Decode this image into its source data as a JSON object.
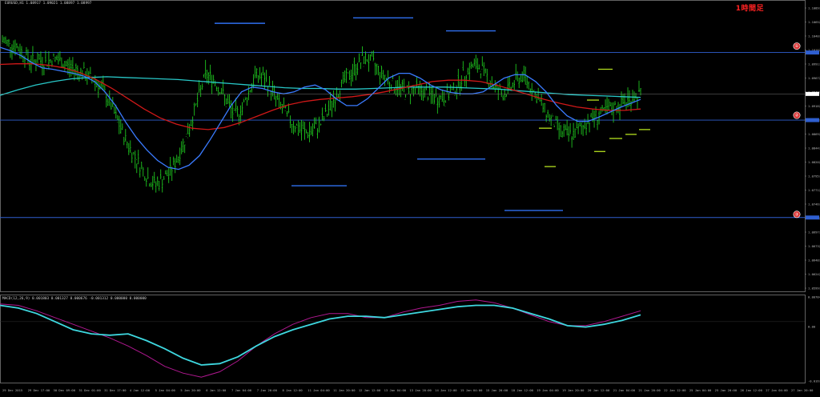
{
  "chart_header": {
    "symbol_line": "EURUSD,H1  1.08917 1.09021 1.08897 1.08997",
    "timeframe_label": "1時間足"
  },
  "indicator_header": "MACD(12,26,9) 0.001803 0.001327 0.000676 -0.001312 0.000000 0.000000",
  "markers": [
    "①",
    "②",
    "③"
  ],
  "colors": {
    "background": "#000000",
    "candle": "#22dd22",
    "ma_fast": "#3a7bff",
    "ma_mid": "#d01818",
    "ma_slow": "#28c8c8",
    "level_line": "#2f5fd0",
    "support_resist": "#2f6ff0",
    "yellow_marks": "#b4e01e",
    "macd_main": "#3ed8e0",
    "macd_signal": "#b01890",
    "grid": "#2a2a2a"
  },
  "chart_data": [
    {
      "type": "line",
      "subtype": "candlestick",
      "title": "EURUSD,H1",
      "series": [
        {
          "name": "candles",
          "style": "ohlc-bars",
          "values": [
            1.0999,
            1.0996,
            1.099,
            1.098,
            1.097,
            1.0972,
            1.0968,
            1.0974,
            1.097,
            1.0962,
            1.0958,
            1.0954,
            1.0946,
            1.094,
            1.0925,
            1.0905,
            1.088,
            1.0855,
            1.0835,
            1.0818,
            1.08,
            1.079,
            1.0797,
            1.0806,
            1.0825,
            1.085,
            1.088,
            1.0915,
            1.095,
            1.0945,
            1.093,
            1.091,
            1.089,
            1.09,
            1.0925,
            1.095,
            1.0945,
            1.093,
            1.091,
            1.0895,
            1.088,
            1.087,
            1.0865,
            1.087,
            1.088,
            1.09,
            1.092,
            1.094,
            1.095,
            1.0965,
            1.0975,
            1.0968,
            1.0955,
            1.0945,
            1.0935,
            1.093,
            1.0925,
            1.093,
            1.0925,
            1.092,
            1.0915,
            1.0918,
            1.0925,
            1.094,
            1.0955,
            1.0963,
            1.096,
            1.0945,
            1.093,
            1.0922,
            1.093,
            1.0945,
            1.0948,
            1.093,
            1.0912,
            1.0895,
            1.088,
            1.0868,
            1.0862,
            1.0865,
            1.0875,
            1.0885,
            1.089,
            1.0895,
            1.09,
            1.0905,
            1.0912,
            1.0918,
            1.0922
          ]
        },
        {
          "name": "ma_fast",
          "values": [
            1.099,
            1.0985,
            1.0978,
            1.0968,
            1.096,
            1.0958,
            1.0955,
            1.0952,
            1.0948,
            1.094,
            1.0925,
            1.0905,
            1.088,
            1.0858,
            1.084,
            1.0825,
            1.0815,
            1.0812,
            1.0818,
            1.0832,
            1.0855,
            1.088,
            1.0905,
            1.0925,
            1.0932,
            1.093,
            1.0925,
            1.0922,
            1.0925,
            1.0932,
            1.0935,
            1.0928,
            1.0915,
            1.0905,
            1.0905,
            1.0915,
            1.093,
            1.0945,
            1.0952,
            1.0952,
            1.0945,
            1.0935,
            1.0928,
            1.0924,
            1.0922,
            1.0922,
            1.0925,
            1.0935,
            1.0945,
            1.095,
            1.095,
            1.094,
            1.0925,
            1.0905,
            1.089,
            1.0882,
            1.0882,
            1.0888,
            1.0895,
            1.0902,
            1.0908,
            1.0914
          ]
        },
        {
          "name": "ma_mid",
          "values": [
            1.0965,
            1.0966,
            1.0966,
            1.0964,
            1.096,
            1.0953,
            1.0943,
            1.093,
            1.0915,
            1.09,
            1.0887,
            1.0878,
            1.0872,
            1.087,
            1.0873,
            1.088,
            1.0889,
            1.0898,
            1.0906,
            1.0911,
            1.0914,
            1.0916,
            1.0918,
            1.0921,
            1.0925,
            1.093,
            1.0935,
            1.094,
            1.0942,
            1.0942,
            1.094,
            1.0935,
            1.0928,
            1.0921,
            1.0914,
            1.0908,
            1.0903,
            1.09,
            1.0898,
            1.0898,
            1.09
          ]
        },
        {
          "name": "ma_slow",
          "values": [
            1.092,
            1.0928,
            1.0935,
            1.094,
            1.0944,
            1.0946,
            1.0947,
            1.0946,
            1.0945,
            1.0944,
            1.0943,
            1.0941,
            1.0939,
            1.0937,
            1.0935,
            1.0933,
            1.0931,
            1.093,
            1.093,
            1.0929,
            1.0929,
            1.093,
            1.0931,
            1.0932,
            1.0932,
            1.0932,
            1.0931,
            1.093,
            1.0929,
            1.0927,
            1.0925,
            1.0923,
            1.0921,
            1.092,
            1.0919,
            1.0918,
            1.0917
          ]
        }
      ],
      "reference_lines": [
        {
          "name": "level-1",
          "value": 1.09824,
          "marker": "①"
        },
        {
          "name": "level-2",
          "value": 1.08838,
          "marker": "②"
        },
        {
          "name": "level-3",
          "value": 1.07417,
          "marker": "③"
        }
      ],
      "ylim": [
        1.0634,
        1.1052
      ],
      "y_tick_labels": [
        "1.10897",
        "1.10652",
        "1.10407",
        "1.10162",
        "1.09917",
        "1.09672",
        "1.09427",
        "1.09182",
        "1.08937",
        "1.08692",
        "1.08447",
        "1.08202",
        "1.07957",
        "1.07712",
        "1.07467",
        "1.07222",
        "1.06977",
        "1.06732",
        "1.06487",
        "1.06242",
        "1.05997"
      ],
      "x_tick_labels": [
        "29 Dec 2015",
        "29 Dec 17:00",
        "30 Dec 09:00",
        "31 Dec 01:00",
        "31 Dec 17:00",
        "4 Jan 12:00",
        "5 Jan 04:00",
        "5 Jan 20:00",
        "6 Jan 12:00",
        "7 Jan 04:00",
        "7 Jan 20:00",
        "8 Jan 12:00",
        "11 Jan 04:00",
        "11 Jan 20:00",
        "12 Jan 12:00",
        "13 Jan 04:00",
        "13 Jan 20:00",
        "14 Jan 12:00",
        "15 Jan 04:00",
        "15 Jan 20:00",
        "18 Jan 12:00",
        "19 Jan 04:00",
        "19 Jan 20:00",
        "20 Jan 12:00",
        "21 Jan 04:00",
        "21 Jan 20:00",
        "22 Jan 12:00",
        "25 Jan 04:00",
        "25 Jan 20:00",
        "26 Jan 12:00",
        "27 Jan 04:00",
        "27 Jan 20:00"
      ],
      "grid": false
    },
    {
      "type": "line",
      "title": "MACD(12,26,9)",
      "series": [
        {
          "name": "main",
          "values": [
            0.0012,
            0.001,
            0.0006,
            0.0,
            -0.0006,
            -0.0009,
            -0.001,
            -0.0009,
            -0.0014,
            -0.002,
            -0.0027,
            -0.0032,
            -0.0031,
            -0.0026,
            -0.0018,
            -0.0011,
            -0.0006,
            -0.0002,
            0.0002,
            0.0004,
            0.0004,
            0.0003,
            0.0005,
            0.0007,
            0.0009,
            0.0011,
            0.0012,
            0.0012,
            0.001,
            0.0006,
            0.0002,
            -0.0003,
            -0.0004,
            -0.0002,
            0.0001,
            0.0005
          ]
        },
        {
          "name": "signal",
          "values": [
            0.0013,
            0.0012,
            0.0008,
            0.0003,
            -0.0002,
            -0.0007,
            -0.0012,
            -0.0018,
            -0.0025,
            -0.0033,
            -0.0038,
            -0.0041,
            -0.0037,
            -0.0029,
            -0.0018,
            -0.0009,
            -0.0002,
            0.0003,
            0.0006,
            0.0006,
            0.0003,
            0.0003,
            0.0007,
            0.001,
            0.0012,
            0.0015,
            0.0016,
            0.0014,
            0.001,
            0.0005,
            0.0,
            -0.0003,
            -0.0003,
            0.0,
            0.0004,
            0.0008
          ]
        }
      ],
      "ylim": [
        -0.0045,
        0.002
      ],
      "y_tick_labels": [
        "0.007844",
        "0.00",
        "-0.016753"
      ],
      "grid": false
    }
  ]
}
